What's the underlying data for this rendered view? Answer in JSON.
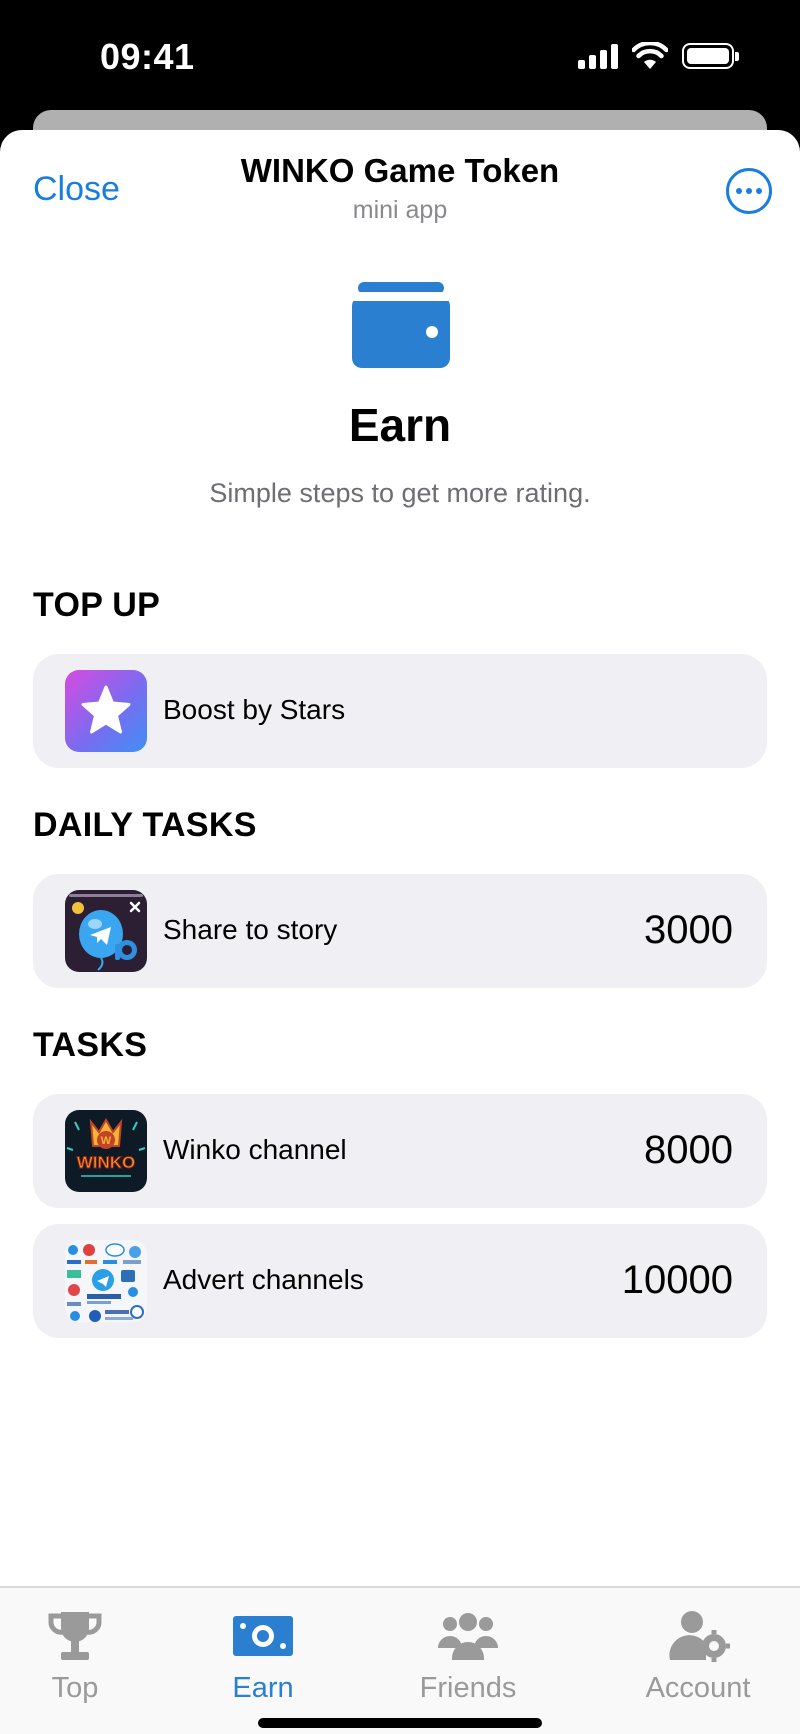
{
  "status_bar": {
    "time": "09:41"
  },
  "header": {
    "close_label": "Close",
    "title": "WINKO Game Token",
    "subtitle": "mini app"
  },
  "hero": {
    "icon": "wallet-icon",
    "title": "Earn",
    "subtitle": "Simple steps to get more rating."
  },
  "sections": {
    "top_up": {
      "label": "TOP UP",
      "items": [
        {
          "label": "Boost by Stars",
          "icon": "star-icon"
        }
      ]
    },
    "daily_tasks": {
      "label": "DAILY TASKS",
      "items": [
        {
          "label": "Share to story",
          "value": "3000",
          "icon": "story-icon"
        }
      ]
    },
    "tasks": {
      "label": "TASKS",
      "items": [
        {
          "label": "Winko channel",
          "value": "8000",
          "icon": "winko-logo",
          "logo_text": "WINKO"
        },
        {
          "label": "Advert channels",
          "value": "10000",
          "icon": "channels-collage"
        }
      ]
    }
  },
  "bottom_nav": {
    "items": [
      {
        "label": "Top",
        "icon": "trophy-icon",
        "active": false
      },
      {
        "label": "Earn",
        "icon": "money-icon",
        "active": true
      },
      {
        "label": "Friends",
        "icon": "users-icon",
        "active": false
      },
      {
        "label": "Account",
        "icon": "user-gear-icon",
        "active": false
      }
    ]
  },
  "colors": {
    "accent": "#1a7ee0",
    "active_tab": "#2a7fd0",
    "inactive_tab": "#9a9a9a",
    "card_bg": "#efeff4"
  }
}
